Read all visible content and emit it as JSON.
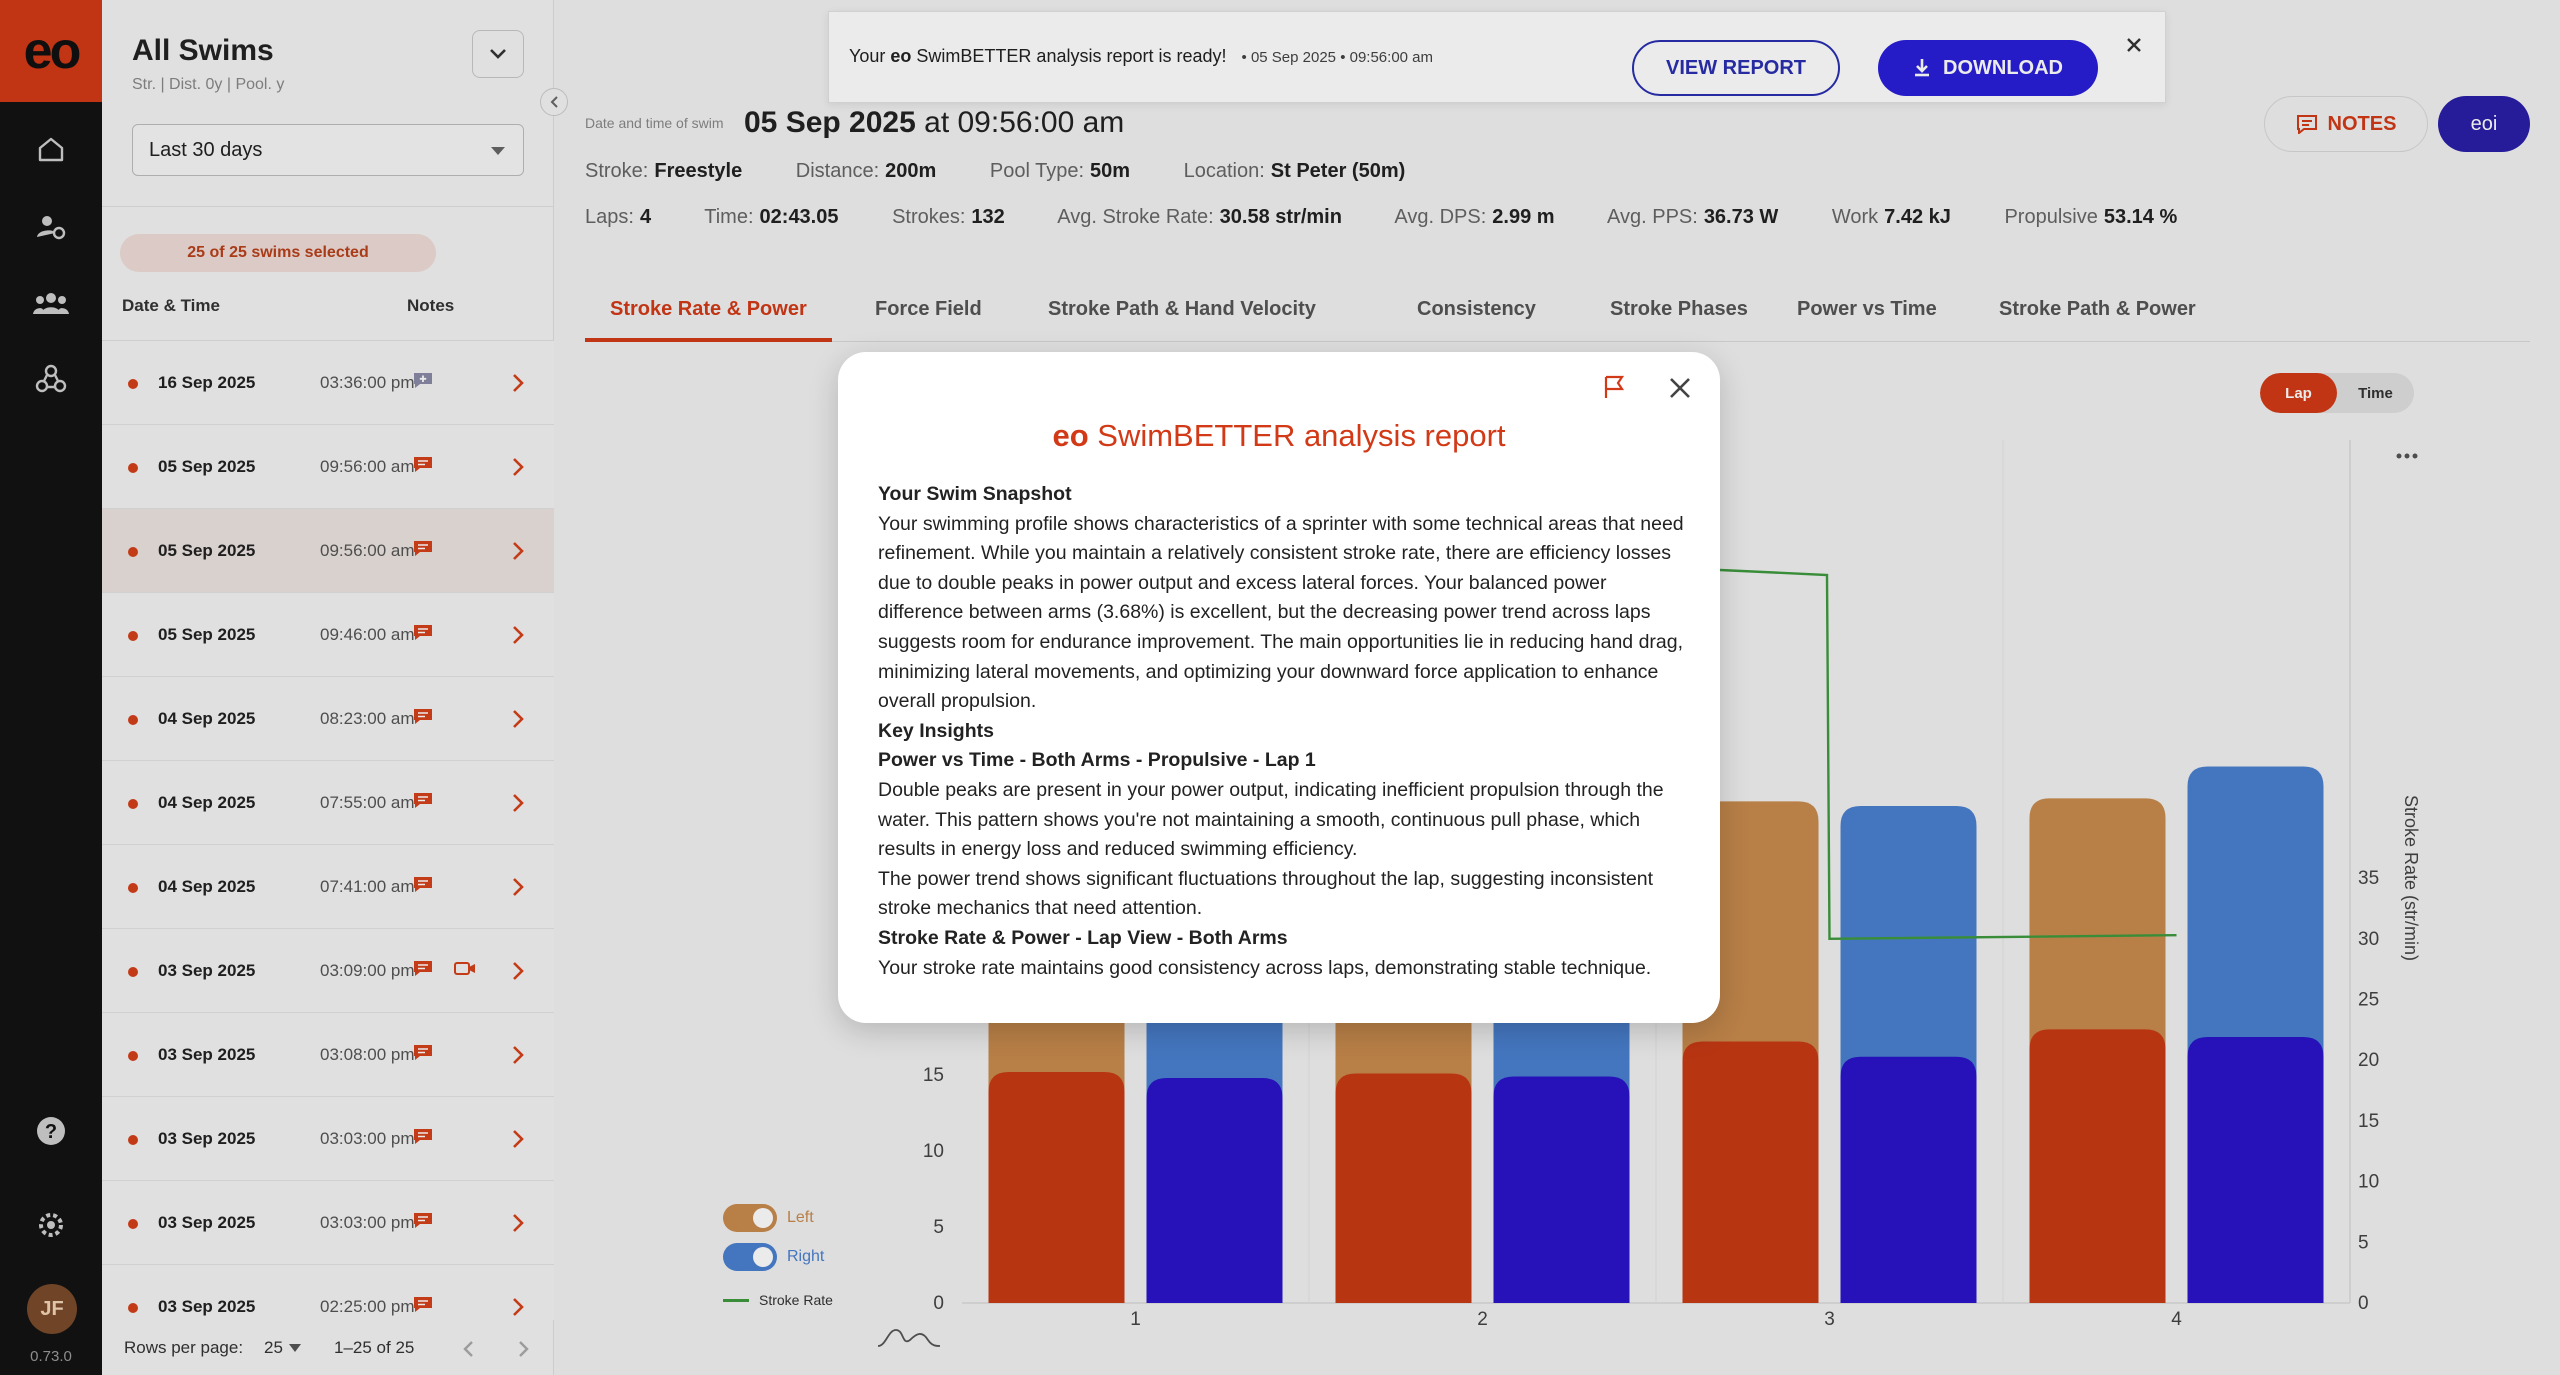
{
  "rail": {
    "logo": "eo",
    "avatar": "JF",
    "version": "0.73.0"
  },
  "panel": {
    "title": "All Swims",
    "subtitle": "Str. | Dist. 0y | Pool. y",
    "range": "Last 30 days",
    "selected_badge": "25 of 25 swims selected",
    "col_date": "Date & Time",
    "col_notes": "Notes",
    "rows": [
      {
        "date": "16 Sep 2025",
        "time": "03:36:00 pm",
        "video": false
      },
      {
        "date": "05 Sep 2025",
        "time": "09:56:00 am",
        "video": false
      },
      {
        "date": "05 Sep 2025",
        "time": "09:56:00 am",
        "video": false,
        "active": true
      },
      {
        "date": "05 Sep 2025",
        "time": "09:46:00 am",
        "video": false
      },
      {
        "date": "04 Sep 2025",
        "time": "08:23:00 am",
        "video": false
      },
      {
        "date": "04 Sep 2025",
        "time": "07:55:00 am",
        "video": false
      },
      {
        "date": "04 Sep 2025",
        "time": "07:41:00 am",
        "video": false
      },
      {
        "date": "03 Sep 2025",
        "time": "03:09:00 pm",
        "video": true
      },
      {
        "date": "03 Sep 2025",
        "time": "03:08:00 pm",
        "video": false
      },
      {
        "date": "03 Sep 2025",
        "time": "03:03:00 pm",
        "video": false
      },
      {
        "date": "03 Sep 2025",
        "time": "03:03:00 pm",
        "video": false
      },
      {
        "date": "03 Sep 2025",
        "time": "02:25:00 pm",
        "video": false
      }
    ],
    "rows_per_page_label": "Rows per page:",
    "rows_per_page": "25",
    "page_range": "1–25 of 25"
  },
  "toast": {
    "prefix": "Your",
    "brand": "eo",
    "message": "SwimBETTER analysis report is ready!",
    "meta": "• 05 Sep 2025 • 09:56:00 am",
    "view": "VIEW REPORT",
    "download": "DOWNLOAD"
  },
  "swim": {
    "date_label": "Date and time of swim",
    "date": "05 Sep 2025",
    "at": "at 09:56:00 am",
    "stroke_k": "Stroke:",
    "stroke_v": "Freestyle",
    "distance_k": "Distance:",
    "distance_v": "200m",
    "pool_k": "Pool Type:",
    "pool_v": "50m",
    "location_k": "Location:",
    "location_v": "St Peter (50m)",
    "laps_k": "Laps:",
    "laps_v": "4",
    "time_k": "Time:",
    "time_v": "02:43.05",
    "strokes_k": "Strokes:",
    "strokes_v": "132",
    "asr_k": "Avg. Stroke Rate:",
    "asr_v": "30.58 str/min",
    "dps_k": "Avg. DPS:",
    "dps_v": "2.99 m",
    "pps_k": "Avg. PPS:",
    "pps_v": "36.73 W",
    "work_k": "Work",
    "work_v": "7.42 kJ",
    "prop_k": "Propulsive",
    "prop_v": "53.14 %"
  },
  "header_buttons": {
    "notes": "NOTES",
    "eoi": "eoi"
  },
  "tabs": [
    "Stroke Rate & Power",
    "Force Field",
    "Stroke Path & Hand Velocity",
    "Consistency",
    "Stroke Phases",
    "Power vs Time",
    "Stroke Path & Power"
  ],
  "segment": {
    "lap": "Lap",
    "time": "Time"
  },
  "legend": {
    "left": "Left",
    "right": "Right",
    "stroke_rate": "Stroke Rate"
  },
  "colors": {
    "brand": "#d23a17",
    "left_light": "#c88a4e",
    "left_dark": "#c83a14",
    "right_light": "#4a80d0",
    "right_dark": "#2a14c8",
    "stroke_rate": "#3e9a3e"
  },
  "chart_data": {
    "type": "bar",
    "categories": [
      "1",
      "2",
      "3",
      "4"
    ],
    "left_axis_ticks": [
      0,
      5,
      10,
      15
    ],
    "ylabel_right": "Stroke Rate (str/min)",
    "right_axis_ticks": [
      0,
      5,
      10,
      15,
      20,
      25,
      30,
      35
    ],
    "series": [
      {
        "name": "Left",
        "propulsive": [
          15.2,
          15.1,
          17.2,
          18.0
        ],
        "total": [
          29.0,
          29.0,
          33.0,
          33.2
        ]
      },
      {
        "name": "Right",
        "propulsive": [
          14.8,
          14.9,
          16.2,
          17.5
        ],
        "total": [
          29.5,
          29.5,
          32.7,
          35.3
        ]
      },
      {
        "name": "Stroke Rate",
        "values": [
          null,
          null,
          30.0,
          30.3
        ]
      }
    ]
  },
  "modal": {
    "brand": "eo",
    "title": "SwimBETTER analysis report",
    "h1": "Your Swim Snapshot",
    "p1": "Your swimming profile shows characteristics of a sprinter with some technical areas that need refinement. While you maintain a relatively consistent stroke rate, there are efficiency losses due to double peaks in power output and excess lateral forces. Your balanced power difference between arms (3.68%) is excellent, but the decreasing power trend across laps suggests room for endurance improvement. The main opportunities lie in reducing hand drag, minimizing lateral movements, and optimizing your downward force application to enhance overall propulsion.",
    "h2": "Key Insights",
    "h3": "Power vs Time - Both Arms - Propulsive - Lap 1",
    "p2": "Double peaks are present in your power output, indicating inefficient propulsion through the water. This pattern shows you're not maintaining a smooth, continuous pull phase, which results in energy loss and reduced swimming efficiency.",
    "p3": "The power trend shows significant fluctuations throughout the lap, suggesting inconsistent stroke mechanics that need attention.",
    "h4": "Stroke Rate & Power - Lap View - Both Arms",
    "p4": "Your stroke rate maintains good consistency across laps, demonstrating stable technique."
  }
}
